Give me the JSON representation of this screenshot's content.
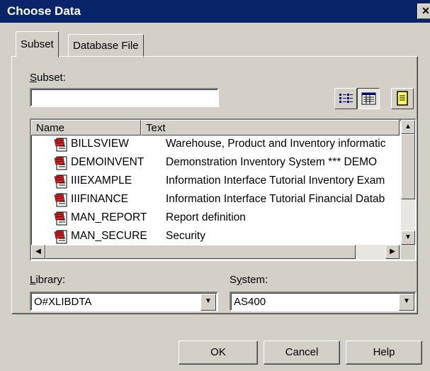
{
  "window": {
    "title": "Choose Data",
    "close_glyph": "✕"
  },
  "tabs": [
    {
      "label": "Subset",
      "active": true
    },
    {
      "label": "Database File",
      "active": false
    }
  ],
  "subset": {
    "label_prefix": "",
    "label_accel": "S",
    "label_rest": "ubset:",
    "value": ""
  },
  "toolbar": {
    "list_view_icon": "list-view-icon",
    "details_view_icon": "details-view-icon",
    "notes_icon": "notes-icon"
  },
  "list": {
    "columns": [
      "Name",
      "Text"
    ],
    "rows": [
      {
        "name": "BILLSVIEW",
        "text": "Warehouse, Product and Inventory informatic"
      },
      {
        "name": "DEMOINVENT",
        "text": "Demonstration Inventory System    *** DEMO"
      },
      {
        "name": "IIIEXAMPLE",
        "text": "Information Interface Tutorial Inventory Exam"
      },
      {
        "name": "IIIFINANCE",
        "text": "Information Interface Tutorial Financial Datab"
      },
      {
        "name": "MAN_REPORT",
        "text": "Report definition"
      },
      {
        "name": "MAN_SECURE",
        "text": "Security"
      }
    ]
  },
  "library": {
    "label_accel": "L",
    "label_rest": "ibrary:",
    "value": "O#XLIBDTA"
  },
  "system": {
    "label_pre": "S",
    "label_accel": "y",
    "label_rest": "stem:",
    "value": "AS400"
  },
  "buttons": {
    "ok": "OK",
    "cancel": "Cancel",
    "help": "Help"
  }
}
